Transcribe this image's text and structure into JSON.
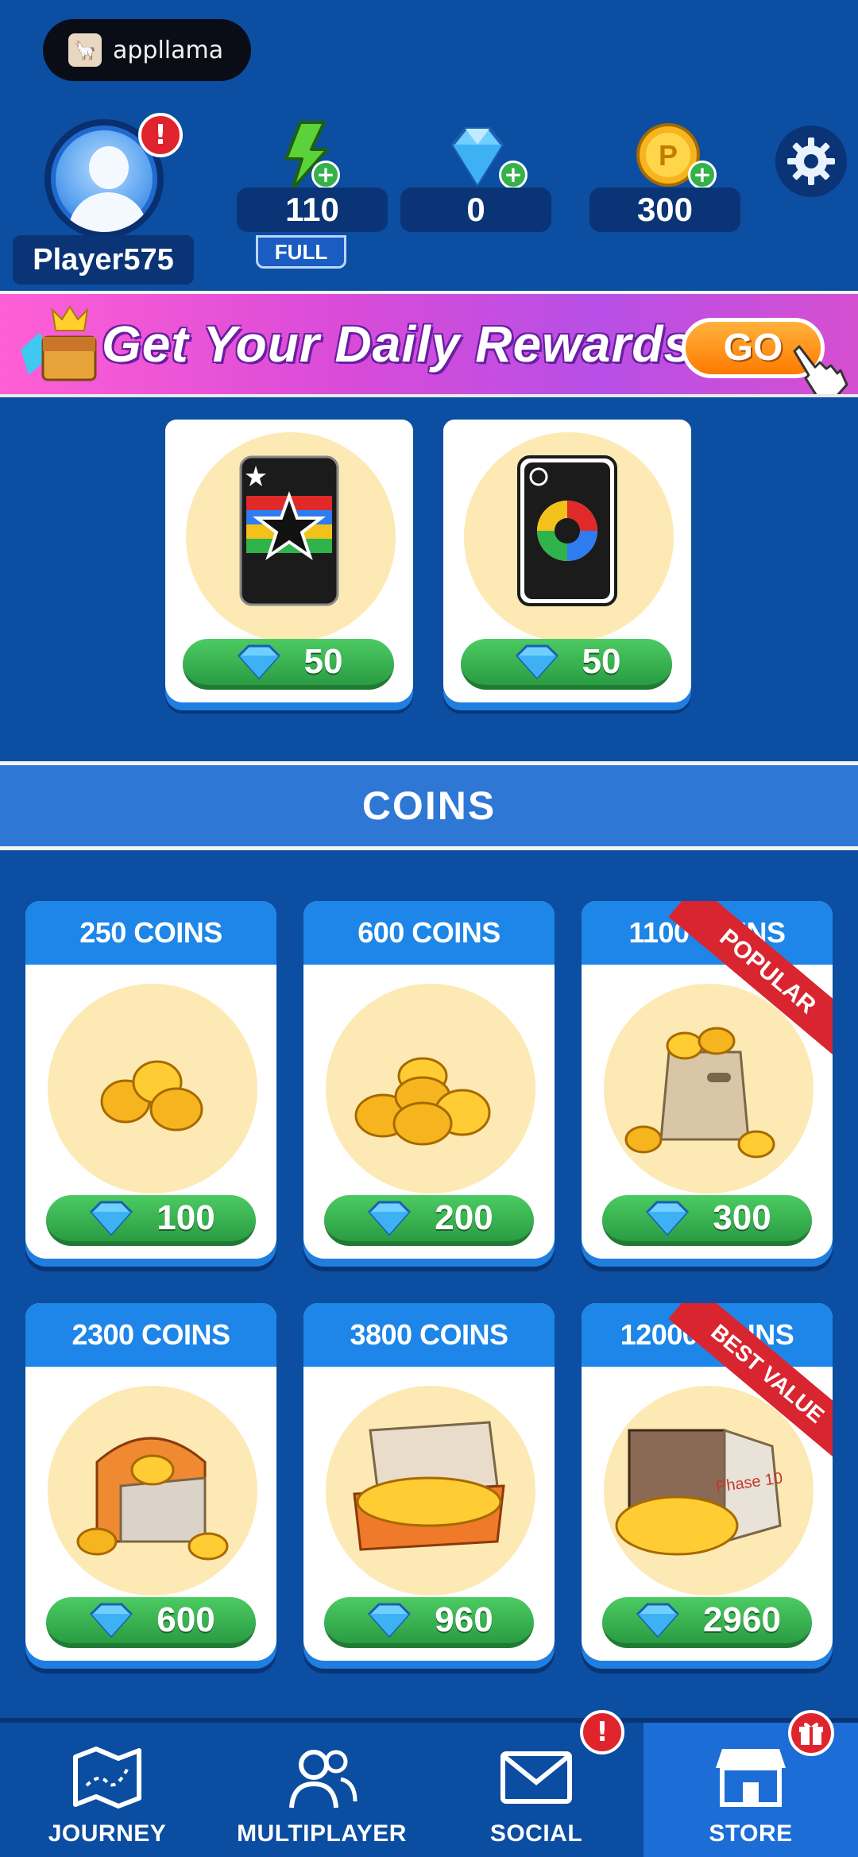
{
  "brand": {
    "name": "appllama"
  },
  "player": {
    "name": "Player575",
    "alert": "!"
  },
  "resources": {
    "energy": {
      "value": "110",
      "status": "FULL",
      "add": "+"
    },
    "gems": {
      "value": "0",
      "add": "+"
    },
    "coins": {
      "value": "300",
      "add": "+"
    }
  },
  "banner": {
    "text": "Get Your Daily Rewards",
    "button": "GO"
  },
  "card_items": [
    {
      "name": "wild-card",
      "price": "50"
    },
    {
      "name": "skip-card",
      "price": "50"
    }
  ],
  "coins_section": {
    "title": "COINS",
    "packs": [
      {
        "label": "250 COINS",
        "price": "100"
      },
      {
        "label": "600 COINS",
        "price": "200"
      },
      {
        "label": "1100 COINS",
        "price": "300",
        "ribbon": "POPULAR"
      },
      {
        "label": "2300 COINS",
        "price": "600"
      },
      {
        "label": "3800 COINS",
        "price": "960"
      },
      {
        "label": "12000 COINS",
        "price": "2960",
        "ribbon": "BEST VALUE"
      }
    ]
  },
  "truck_text": "Phase 10",
  "nav": {
    "items": [
      {
        "label": "JOURNEY"
      },
      {
        "label": "MULTIPLAYER"
      },
      {
        "label": "SOCIAL",
        "badge": "!"
      },
      {
        "label": "STORE"
      }
    ],
    "active": "STORE"
  },
  "colors": {
    "background": "#0b4ea2",
    "price_green": "#2a9c43",
    "ribbon_red": "#d92530",
    "header_blue": "#1d86e8"
  }
}
